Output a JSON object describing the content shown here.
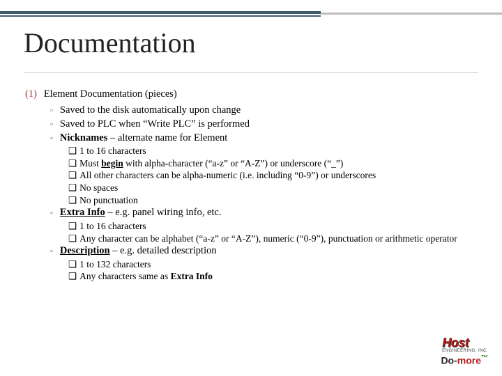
{
  "title": "Documentation",
  "l1": {
    "num": "(1)",
    "text": "Element Documentation (pieces)"
  },
  "l2a": "Saved to the disk automatically upon change",
  "l2b": "Saved to PLC when “Write PLC” is performed",
  "l2c_b": "Nicknames",
  "l2c_rest": " – alternate name for Element",
  "n1": " 1 to 16 characters",
  "n2a": "Must ",
  "n2b": "begin",
  "n2c": " with alpha-character (“a-z” or “A-Z”) or underscore (“_”)",
  "n3": "All other characters can be alpha-numeric (i.e. including “0-9”) or underscores",
  "n4": "No spaces",
  "n5": "No punctuation",
  "l2d_b": "Extra Info",
  "l2d_rest": " – e.g. panel wiring info, etc.",
  "e1": " 1 to 16 characters",
  "e2": "Any character can be alphabet (“a-z” or “A-Z”), numeric (“0-9”), punctuation or arithmetic operator",
  "l2e_b": "Description",
  "l2e_rest": " – e.g. detailed description",
  "d1": " 1 to 132 characters",
  "d2a": "Any characters same as ",
  "d2b": "Extra Info",
  "sq": "❑",
  "smsq": "▫",
  "logo": {
    "host": "Host",
    "hostsub": "ENGINEERING, INC.",
    "do": "Do-",
    "more": "more",
    "tm": "™"
  }
}
